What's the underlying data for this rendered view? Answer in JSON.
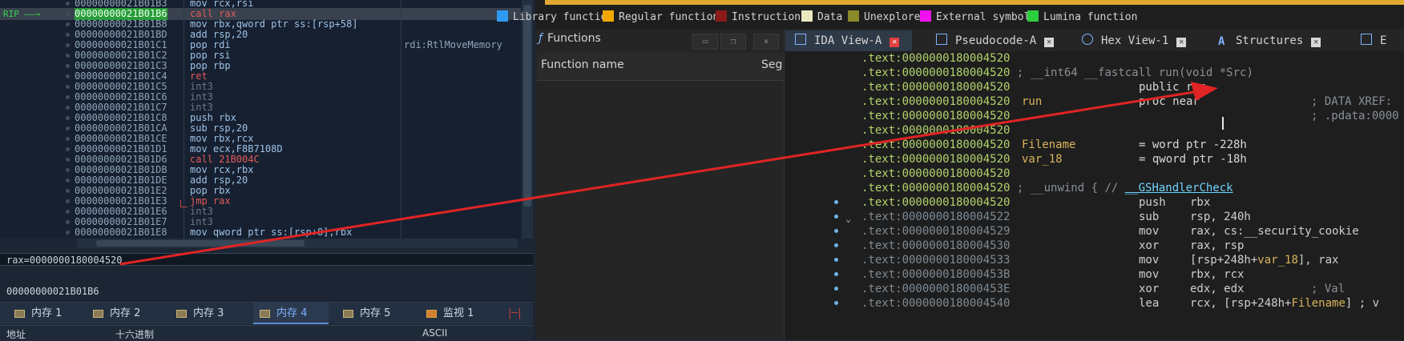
{
  "debugger": {
    "rip_label": "RIP",
    "rows": [
      {
        "addr": "00000000021B01B3",
        "ins": "mov rcx,rsi",
        "cmt": ""
      },
      {
        "addr": "00000000021B01B6",
        "ins": "call rax",
        "cmt": ""
      },
      {
        "addr": "00000000021B01B8",
        "ins": "mov rbx,qword ptr ss:[rsp+58]",
        "cmt": ""
      },
      {
        "addr": "00000000021B01BD",
        "ins": "add rsp,20",
        "cmt": ""
      },
      {
        "addr": "00000000021B01C1",
        "ins": "pop rdi",
        "cmt": "rdi:RtlMoveMemory"
      },
      {
        "addr": "00000000021B01C2",
        "ins": "pop rsi",
        "cmt": ""
      },
      {
        "addr": "00000000021B01C3",
        "ins": "pop rbp",
        "cmt": ""
      },
      {
        "addr": "00000000021B01C4",
        "ins": "ret",
        "cmt": ""
      },
      {
        "addr": "00000000021B01C5",
        "ins": "int3",
        "cmt": ""
      },
      {
        "addr": "00000000021B01C6",
        "ins": "int3",
        "cmt": ""
      },
      {
        "addr": "00000000021B01C7",
        "ins": "int3",
        "cmt": ""
      },
      {
        "addr": "00000000021B01C8",
        "ins": "push rbx",
        "cmt": ""
      },
      {
        "addr": "00000000021B01CA",
        "ins": "sub rsp,20",
        "cmt": ""
      },
      {
        "addr": "00000000021B01CE",
        "ins": "mov rbx,rcx",
        "cmt": ""
      },
      {
        "addr": "00000000021B01D1",
        "ins": "mov ecx,F8B7108D",
        "cmt": ""
      },
      {
        "addr": "00000000021B01D6",
        "ins": "call 21B004C",
        "cmt": ""
      },
      {
        "addr": "00000000021B01DB",
        "ins": "mov rcx,rbx",
        "cmt": ""
      },
      {
        "addr": "00000000021B01DE",
        "ins": "add rsp,20",
        "cmt": ""
      },
      {
        "addr": "00000000021B01E2",
        "ins": "pop rbx",
        "cmt": ""
      },
      {
        "addr": "00000000021B01E3",
        "ins": "jmp rax",
        "cmt": ""
      },
      {
        "addr": "00000000021B01E6",
        "ins": "int3",
        "cmt": ""
      },
      {
        "addr": "00000000021B01E7",
        "ins": "int3",
        "cmt": ""
      },
      {
        "addr": "00000000021B01E8",
        "ins": "mov qword ptr ss:[rsp+8],rbx",
        "cmt": ""
      }
    ],
    "rax_info": "rax=0000000180004520",
    "addr_info": "00000000021B01B6",
    "tabs": [
      "内存 1",
      "内存 2",
      "内存 3",
      "内存 4",
      "内存 5",
      "监视 1"
    ],
    "columns": [
      "地址",
      "十六进制",
      "ASCII"
    ]
  },
  "ida": {
    "legend": [
      {
        "label": "Library function",
        "color": "#2e9af2"
      },
      {
        "label": "Regular function",
        "color": "#f0a800"
      },
      {
        "label": "Instruction",
        "color": "#8b1a1a"
      },
      {
        "label": "Data",
        "color": "#ece8c0"
      },
      {
        "label": "Unexplored",
        "color": "#8a8a2a"
      },
      {
        "label": "External symbol",
        "color": "#f012f0"
      },
      {
        "label": "Lumina function",
        "color": "#2dcc3c"
      }
    ],
    "functions_title": "Functions",
    "func_col_name": "Function name",
    "func_col_seg": "Seg",
    "tabs": [
      "IDA View-A",
      "Pseudocode-A",
      "Hex View-1",
      "Structures"
    ],
    "code": {
      "l0": ".text:0000000180004520",
      "l1_addr": ".text:0000000180004520",
      "l1_cmt": " ; __int64 __fastcall run(void *Src)",
      "l2_addr": ".text:0000000180004520",
      "l2_txt": "public run",
      "l3_addr": ".text:0000000180004520",
      "l3_lbl": "run",
      "l3_txt": "proc near",
      "l3_cmt": "; DATA XREF:",
      "l4_addr": ".text:0000000180004520",
      "l4_cmt": "; .pdata:0000",
      "l5": ".text:0000000180004520",
      "l6_addr": ".text:0000000180004520",
      "l6_lbl": "Filename",
      "l6_txt": "= word ptr -228h",
      "l7_addr": ".text:0000000180004520",
      "l7_lbl": "var_18",
      "l7_txt": "= qword ptr -18h",
      "l8": ".text:0000000180004520",
      "l9_addr": ".text:0000000180004520",
      "l9_cmt": " ; __unwind { // ",
      "l9_gs": "__GSHandlerCheck",
      "l10_addr": ".text:0000000180004520",
      "l10_op": "push",
      "l10_arg": "rbx",
      "l11_addr": ".text:0000000180004522",
      "l11_op": "sub",
      "l11_arg": "rsp, 240h",
      "l12_addr": ".text:0000000180004529",
      "l12_op": "mov",
      "l12_arg": "rax, cs:__security_cookie",
      "l13_addr": ".text:0000000180004530",
      "l13_op": "xor",
      "l13_arg": "rax, rsp",
      "l14_addr": ".text:0000000180004533",
      "l14_op": "mov",
      "l14_arg1": "[rsp+248h+",
      "l14_var": "var_18",
      "l14_arg2": "], rax",
      "l15_addr": ".text:000000018000453B",
      "l15_op": "mov",
      "l15_arg": "rbx, rcx",
      "l16_addr": ".text:000000018000453E",
      "l16_op": "xor",
      "l16_arg": "edx, edx",
      "l16_cmt": "; Val",
      "l17_addr": ".text:0000000180004540",
      "l17_op": "lea",
      "l17_arg1": "rcx, [rsp+248h+",
      "l17_var": "Filename",
      "l17_arg2": "] ; v"
    }
  }
}
